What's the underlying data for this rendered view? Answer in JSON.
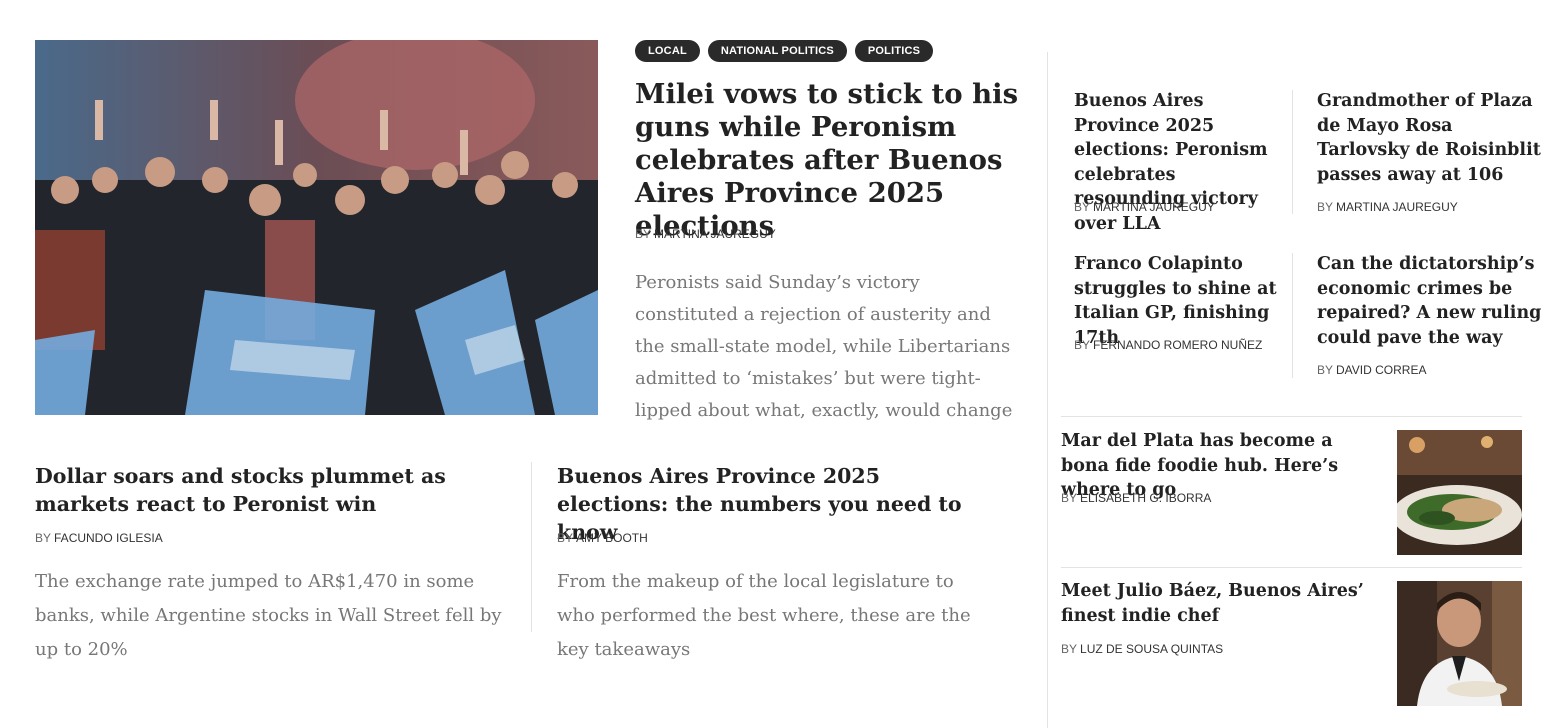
{
  "lead": {
    "tags": [
      "LOCAL",
      "NATIONAL POLITICS",
      "POLITICS"
    ],
    "title": "Milei vows to stick to his guns while Peronism celebrates after Buenos Aires Province 2025 elections",
    "by_prefix": "BY",
    "author": "MARTINA JAUREGUY",
    "summary": "Peronists said Sunday’s victory constituted a rejection of austerity and the small-state model, while Libertarians admitted to ‘mistakes’ but were tight-lipped about what, exactly, would change",
    "image_icon": "crowd-celebration-photo"
  },
  "secondary": [
    {
      "title": "Dollar soars and stocks plummet as markets react to Peronist win",
      "by_prefix": "BY",
      "author": "FACUNDO IGLESIA",
      "summary": "The exchange rate jumped to AR$1,470 in some banks, while Argentine stocks in Wall Street fell by up to 20%"
    },
    {
      "title": "Buenos Aires Province 2025 elections: the numbers you need to know",
      "by_prefix": "BY",
      "author": "AMY BOOTH",
      "summary": "From the makeup of the local legislature to who performed the best where, these are the key takeaways"
    }
  ],
  "sidebar_grid": [
    {
      "title": "Buenos Aires Province 2025 elections: Peronism celebrates resounding victory over LLA",
      "by_prefix": "BY",
      "author": "MARTINA JAUREGUY"
    },
    {
      "title": "Grandmother of Plaza de Mayo Rosa Tarlovsky de Roisinblit passes away at 106",
      "by_prefix": "BY",
      "author": "MARTINA JAUREGUY"
    },
    {
      "title": "Franco Colapinto struggles to shine at Italian GP, finishing 17th",
      "by_prefix": "BY",
      "author": "FERNANDO ROMERO NUÑEZ"
    },
    {
      "title": "Can the dictatorship’s economic crimes be repaired? A new ruling could pave the way",
      "by_prefix": "BY",
      "author": "DAVID CORREA"
    }
  ],
  "sidebar_list": [
    {
      "title": "Mar del Plata has become a bona fide foodie hub. Here’s where to go",
      "by_prefix": "BY",
      "author": "ELISABETH G. IBORRA",
      "image_icon": "food-plate-photo"
    },
    {
      "title": "Meet Julio Báez, Buenos Aires’ finest indie chef",
      "by_prefix": "BY",
      "author": "LUZ DE SOUSA QUINTAS",
      "image_icon": "chef-portrait-photo"
    }
  ],
  "colors": {
    "tag_bg": "#2a2a2a",
    "headline": "#222222",
    "summary": "#777777",
    "flag_blue": "#74acdf"
  }
}
